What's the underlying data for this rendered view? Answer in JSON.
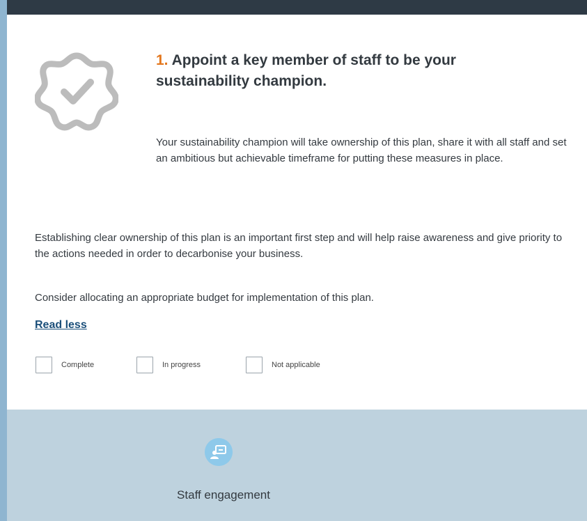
{
  "card": {
    "step_number": "1.",
    "title": "Appoint a key member of staff to be your sustainability champion.",
    "summary": "Your sustainability champion will take ownership of this plan, share it with all staff and set an ambitious but achievable timeframe for putting these measures in place.",
    "details": [
      "Establishing clear ownership of this plan is an important first step and will help raise awareness and give priority to the actions needed in order to decarbonise your business.",
      "Consider allocating an appropriate budget for implementation of this plan."
    ],
    "read_less_label": "Read less",
    "status_options": [
      {
        "label": "Complete",
        "checked": false
      },
      {
        "label": "In progress",
        "checked": false
      },
      {
        "label": "Not applicable",
        "checked": false
      }
    ],
    "icon": "verified-badge-icon"
  },
  "category": {
    "icon": "staff-presentation-icon",
    "label": "Staff engagement"
  },
  "colors": {
    "accent_orange": "#e3761c",
    "link_blue": "#1b4f7a",
    "panel_blue": "#bed2de",
    "icon_circle": "#8ec9ea",
    "top_bar": "#2e3a45"
  }
}
